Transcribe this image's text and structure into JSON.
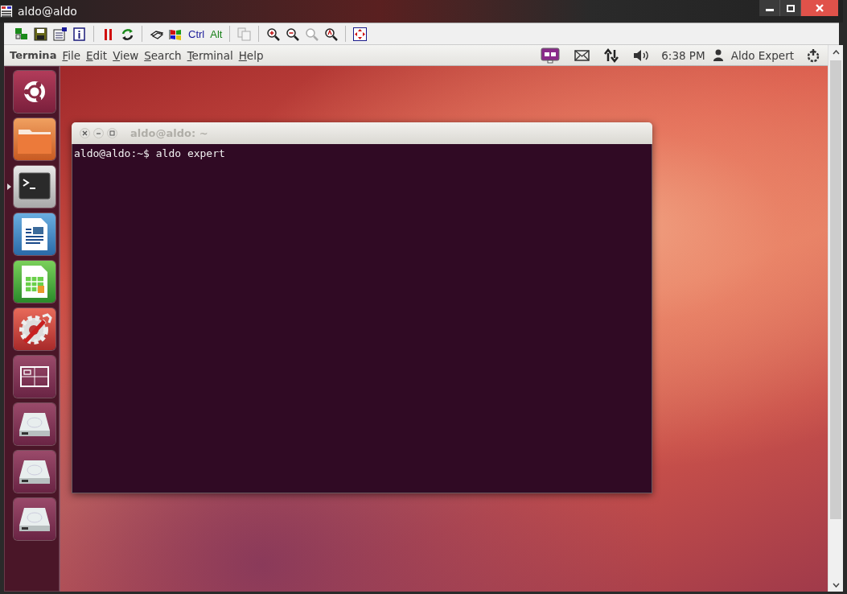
{
  "window": {
    "title": "aldo@aldo"
  },
  "toolbar": {
    "keys": [
      "Ctrl",
      "Alt"
    ]
  },
  "panel": {
    "app_name": "Termina",
    "menus": [
      "File",
      "Edit",
      "View",
      "Search",
      "Terminal",
      "Help"
    ],
    "clock": "6:38 PM",
    "user": "Aldo Expert"
  },
  "launcher": {
    "items": [
      {
        "kind": "ubuntu",
        "running": false
      },
      {
        "kind": "files",
        "running": false
      },
      {
        "kind": "terminal",
        "running": true
      },
      {
        "kind": "writer",
        "running": false
      },
      {
        "kind": "calc",
        "running": false
      },
      {
        "kind": "settings",
        "running": false
      },
      {
        "kind": "workspaces",
        "running": false
      },
      {
        "kind": "drive",
        "running": false
      },
      {
        "kind": "drive",
        "running": false
      },
      {
        "kind": "drive",
        "running": false
      }
    ]
  },
  "terminal": {
    "title": "aldo@aldo: ~",
    "lines": [
      "aldo@aldo:~$ aldo expert"
    ]
  }
}
